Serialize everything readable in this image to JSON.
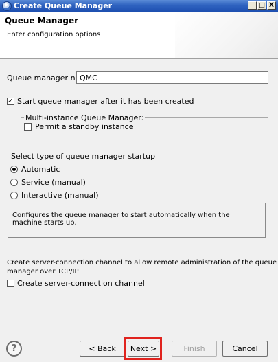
{
  "window": {
    "title": "Create Queue Manager",
    "controls": {
      "minimize": "_",
      "maximize": "□",
      "close": "X"
    }
  },
  "banner": {
    "title": "Queue Manager",
    "description": "Enter configuration options"
  },
  "form": {
    "qm_name_label": "Queue manager name:",
    "qm_name_value": "QMC",
    "start_after_create": {
      "label": "Start queue manager after it has been created",
      "checked": true
    },
    "multi_instance": {
      "legend": "Multi-instance Queue Manager:",
      "permit_standby": {
        "label": "Permit a standby instance",
        "checked": false
      }
    },
    "startup_type": {
      "label": "Select type of queue manager startup",
      "options": [
        "Automatic",
        "Service (manual)",
        "Interactive (manual)"
      ],
      "selected": "Automatic"
    },
    "startup_description": "Configures the queue manager to start automatically when the machine starts up.",
    "server_conn": {
      "text_line1": "Create server-connection channel to allow remote administration of the queue",
      "text_line2": "manager over TCP/IP",
      "checkbox_label": "Create server-connection channel",
      "checked": false
    }
  },
  "buttons": {
    "help": "?",
    "back": "< Back",
    "next": "Next >",
    "finish": "Finish",
    "cancel": "Cancel"
  },
  "colors": {
    "highlight": "#e0231e",
    "titlebar": "#2f63c0"
  }
}
